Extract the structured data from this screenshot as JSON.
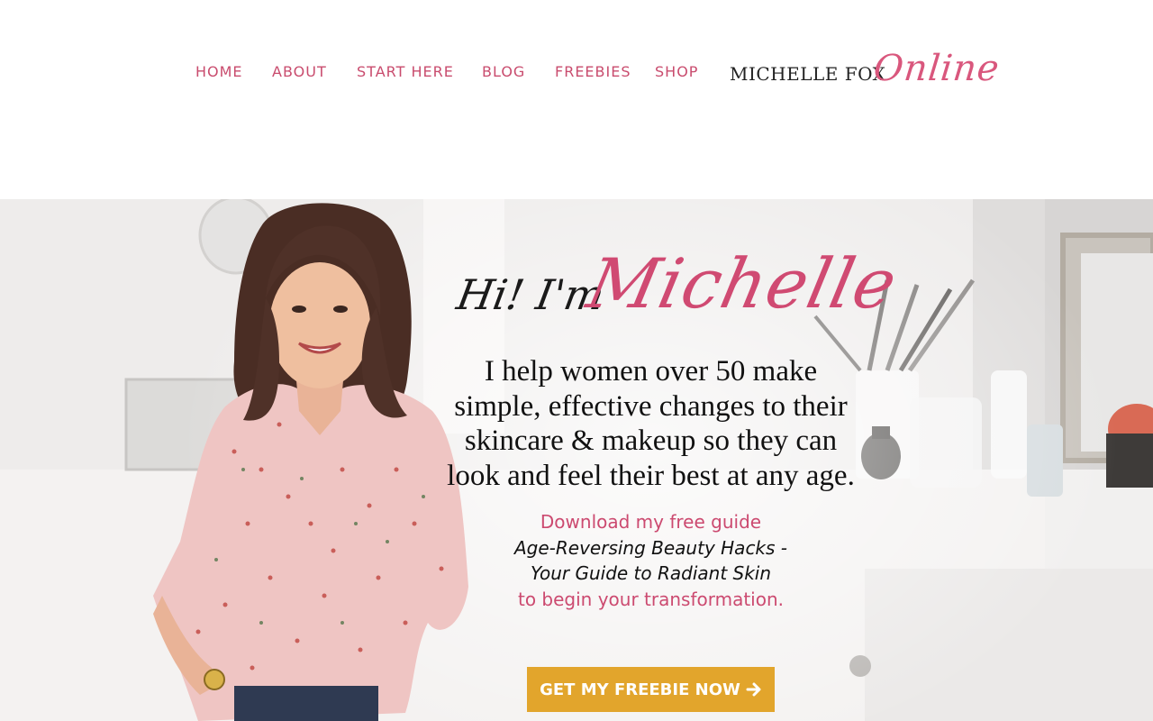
{
  "nav": {
    "items": [
      {
        "label": "HOME"
      },
      {
        "label": "ABOUT"
      },
      {
        "label": "START HERE"
      },
      {
        "label": "BLOG"
      },
      {
        "label": "FREEBIES"
      },
      {
        "label": "SHOP"
      }
    ]
  },
  "logo": {
    "text": "MICHELLE FOX",
    "script": "Online"
  },
  "hero": {
    "greeting_prefix": "Hi! I'm",
    "greeting_name": "Michelle",
    "tagline": "I help women over 50 make simple, effective changes to their skincare & makeup so they can look and feel their best at any age.",
    "guide_intro": "Download my free guide",
    "guide_title_line1": "Age-Reversing Beauty Hacks -",
    "guide_title_line2": "Your Guide to Radiant Skin",
    "guide_outro": "to begin your transformation.",
    "cta_label": "GET MY FREEBIE NOW",
    "cta_icon": "arrow-right-icon"
  },
  "colors": {
    "accent_pink": "#c94c6e",
    "cta_gold": "#e2a52c",
    "text_dark": "#111111"
  }
}
